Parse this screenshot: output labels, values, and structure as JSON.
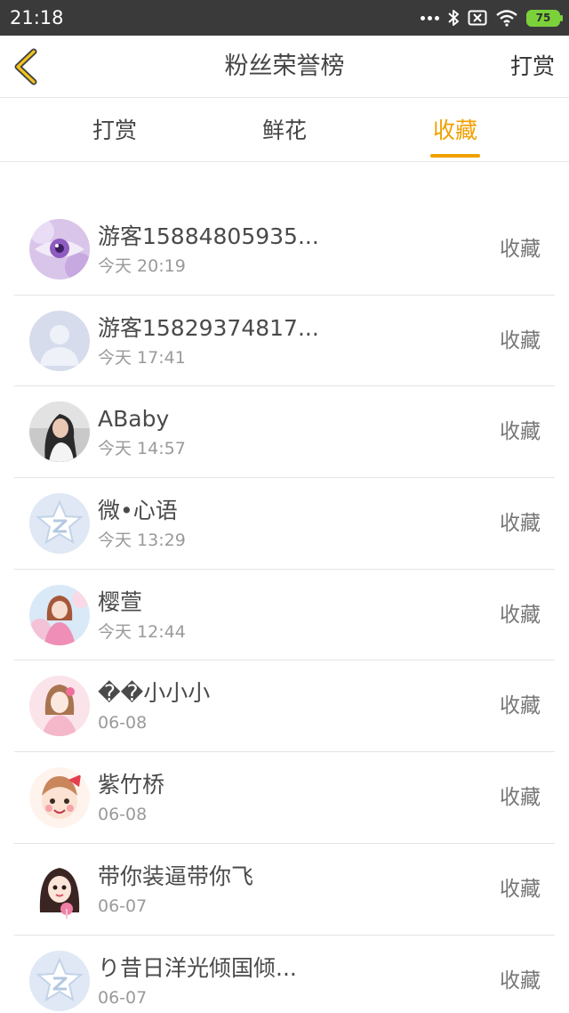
{
  "status_bar": {
    "time": "21:18",
    "battery": "75"
  },
  "header": {
    "title": "粉丝荣誉榜",
    "right_link": "打赏"
  },
  "tabs": [
    {
      "label": "打赏"
    },
    {
      "label": "鲜花"
    },
    {
      "label": "收藏"
    }
  ],
  "active_tab": "收藏",
  "fans": [
    {
      "name": "游客15884805935...",
      "time": "今天 20:19",
      "action": "收藏",
      "avatar": "eye-avatar"
    },
    {
      "name": "游客15829374817...",
      "time": "今天 17:41",
      "action": "收藏",
      "avatar": "default-user-avatar"
    },
    {
      "name": "ABaby",
      "time": "今天 14:57",
      "action": "收藏",
      "avatar": "photo-avatar"
    },
    {
      "name": "微•心语",
      "time": "今天 13:29",
      "action": "收藏",
      "avatar": "default-star-avatar"
    },
    {
      "name": "樱萱",
      "time": "今天 12:44",
      "action": "收藏",
      "avatar": "anime-avatar"
    },
    {
      "name": "��小小小",
      "time": "06-08",
      "action": "收藏",
      "avatar": "cartoon-girl-avatar"
    },
    {
      "name": "紫竹桥",
      "time": "06-08",
      "action": "收藏",
      "avatar": "cartoon-bow-avatar"
    },
    {
      "name": "带你装逼带你飞",
      "time": "06-07",
      "action": "收藏",
      "avatar": "cartoon-face-avatar"
    },
    {
      "name": "り昔日洋光倾国倾...",
      "time": "06-07",
      "action": "收藏",
      "avatar": "default-star-avatar"
    }
  ],
  "colors": {
    "accent": "#f0a000",
    "status_bar": "#3a3a3a",
    "battery": "#7bd13a"
  }
}
